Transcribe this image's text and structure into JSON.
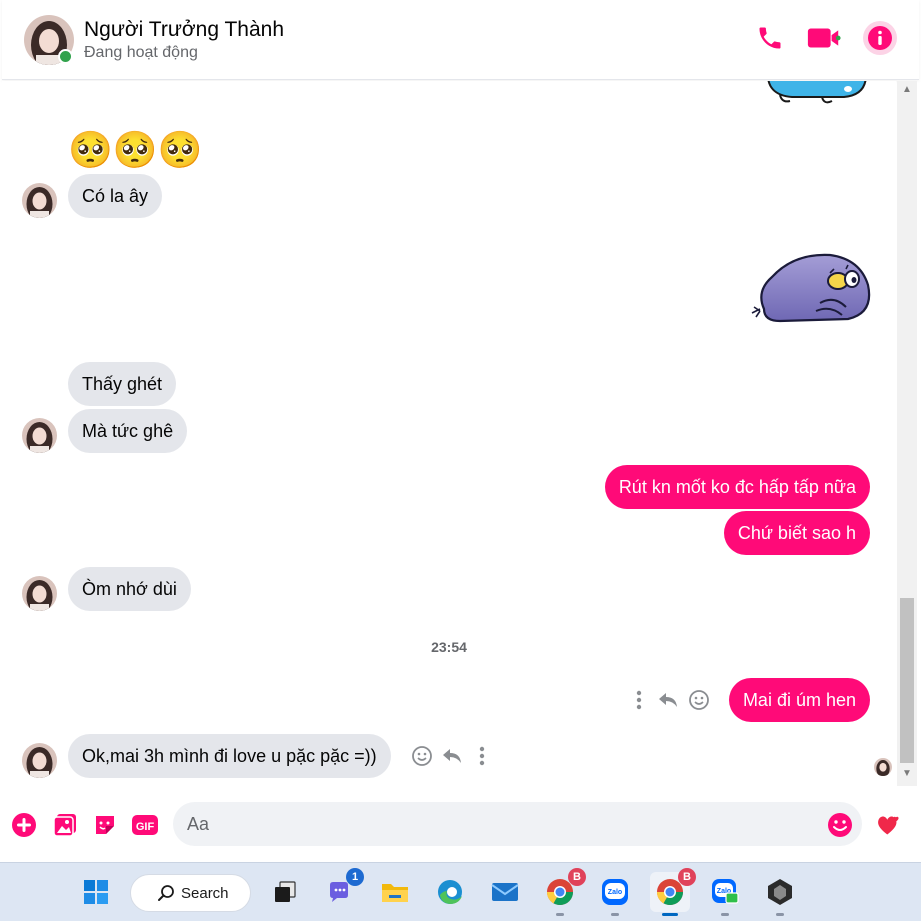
{
  "header": {
    "name": "Người Trưởng Thành",
    "status": "Đang hoạt động",
    "accent": "#ff0a78",
    "online_color": "#31a24c"
  },
  "messages": {
    "emoji_reaction": "🥺🥺🥺",
    "m1": "Có la ây",
    "m2": "Thấy ghét",
    "m3": "Mà tức ghê",
    "m4": "Rút kn mốt ko đc hấp tấp nữa",
    "m5": "Chứ biết sao h",
    "m6": "Òm nhớ dùi",
    "timestamp": "23:54",
    "m7": "Mai đi úm hen",
    "m8": "Ok,mai 3h mình đi love u pặc pặc =))"
  },
  "composer": {
    "placeholder": "Aa",
    "icons": [
      "plus-icon",
      "photo-icon",
      "sticker-icon",
      "gif-icon",
      "emoji-icon",
      "heart-icon"
    ],
    "gif_label": "GIF"
  },
  "taskbar": {
    "search_label": "Search",
    "teams_badge": "1",
    "chrome_badge": "B",
    "zalo_label": "Zalo",
    "items": [
      "windows-start",
      "search",
      "task-view",
      "teams",
      "file-explorer",
      "edge",
      "mail",
      "chrome",
      "zalo",
      "chrome-active",
      "zalo-chat",
      "unity"
    ]
  }
}
